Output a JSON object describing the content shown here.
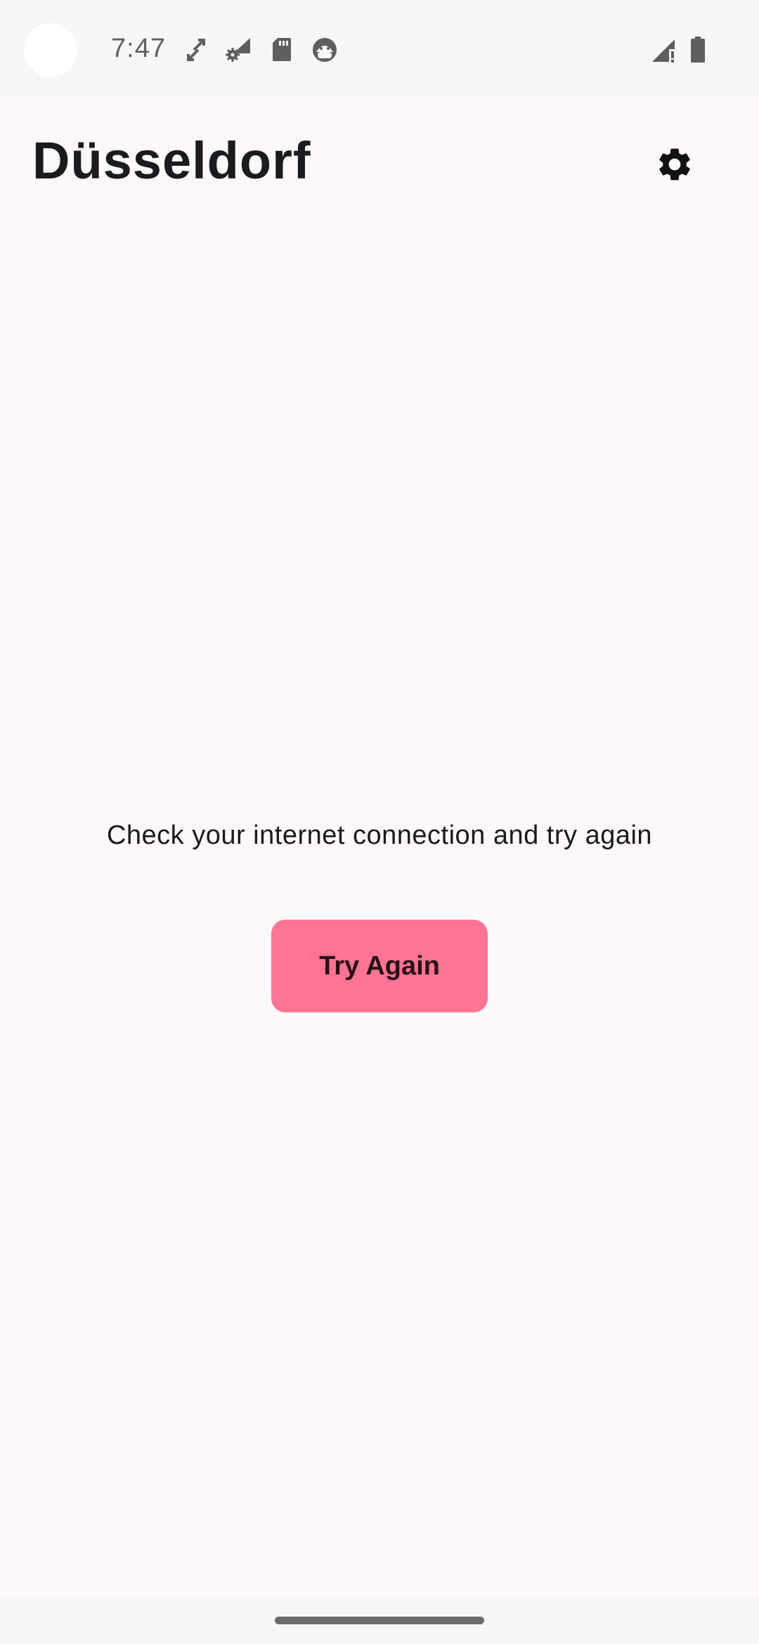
{
  "status_bar": {
    "time": "7:47",
    "icons": [
      "sync-icon",
      "wifi-settings-icon",
      "sd-card-icon",
      "android-face-icon",
      "signal-no-data-icon",
      "battery-icon"
    ]
  },
  "header": {
    "title": "Düsseldorf",
    "settings_icon": "gear-icon"
  },
  "content": {
    "message": "Check your internet connection and try again",
    "button_label": "Try Again"
  },
  "colors": {
    "background": "#fdf8fa",
    "accent": "#ff7494",
    "title_text": "#1b1b1f"
  }
}
